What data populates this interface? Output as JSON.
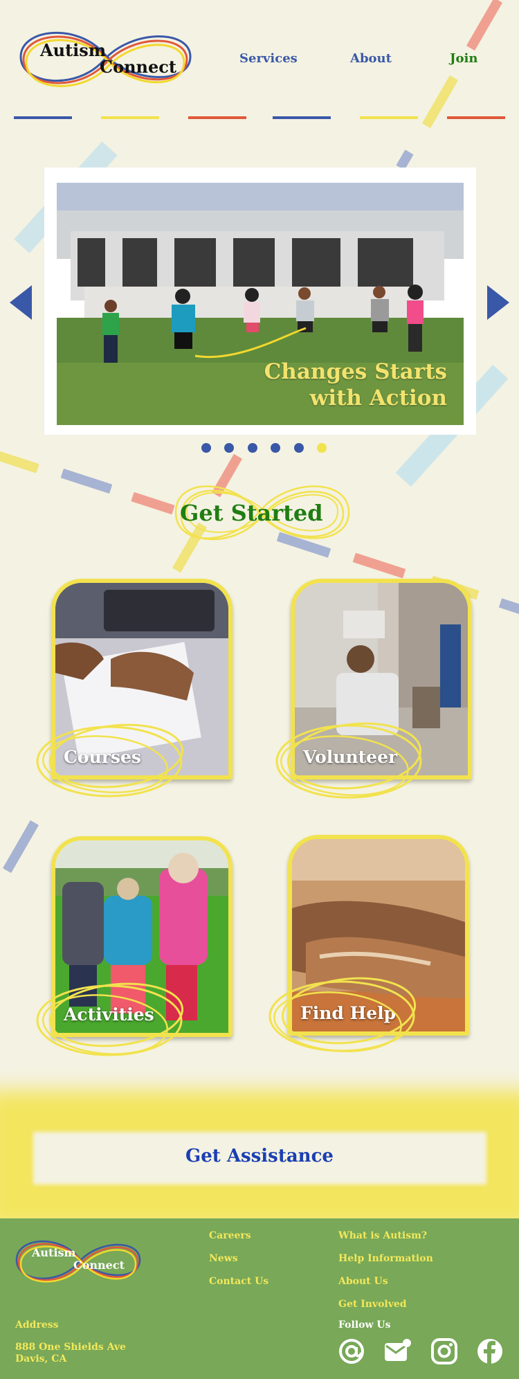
{
  "brand": {
    "line1": "Autism",
    "line2": "Connect"
  },
  "nav": {
    "services": "Services",
    "about": "About",
    "join": "Join"
  },
  "hero": {
    "line1": "Changes Starts",
    "line2": "with Action",
    "slide_count": 6,
    "active_slide": 6
  },
  "get_started": {
    "title": "Get Started"
  },
  "cards": {
    "courses": "Courses",
    "volunteer": "Volunteer",
    "activities": "Activities",
    "find_help": "Find Help"
  },
  "assist": {
    "label": "Get Assistance"
  },
  "footer": {
    "brand": {
      "line1": "Autism",
      "line2": "Connect"
    },
    "col1": [
      "Careers",
      "News",
      "Contact Us"
    ],
    "col2": [
      "What is Autism?",
      "Help Information",
      "About Us",
      "Get Involved"
    ],
    "follow_heading": "Follow Us",
    "address_heading": "Address",
    "address_line1": "888 One Shields Ave",
    "address_line2": "Davis, CA",
    "social_icons": [
      "at-sign-icon",
      "email-icon",
      "instagram-icon",
      "facebook-icon"
    ]
  },
  "colors": {
    "background": "#f4f2e2",
    "blue": "#3a58a8",
    "yellow": "#f2e24e",
    "red": "#e0583a",
    "green": "#1f7d13",
    "footer": "#78a858"
  }
}
